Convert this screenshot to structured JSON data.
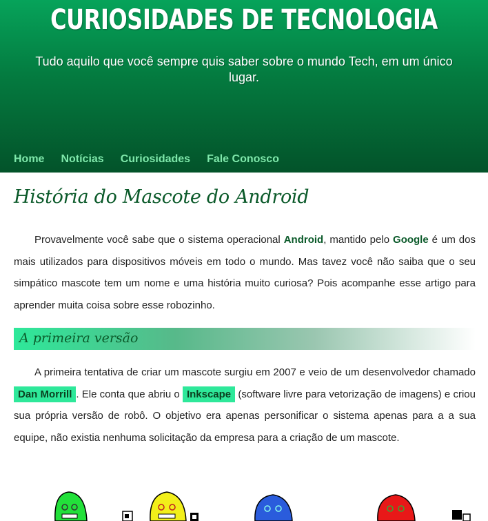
{
  "header": {
    "title": "CURIOSIDADES DE TECNOLOGIA",
    "subtitle": "Tudo aquilo que você sempre quis saber sobre o mundo Tech, em um único lugar."
  },
  "nav": {
    "items": [
      "Home",
      "Notícias",
      "Curiosidades",
      "Fale Conosco"
    ]
  },
  "article": {
    "title": "História do Mascote do Android",
    "intro": {
      "t1": "Provavelmente você sabe que o sistema operacional ",
      "android": "Android",
      "t2": ", mantido pelo ",
      "google": "Google",
      "t3": " é um dos mais utilizados para dispositivos móveis em todo o mundo. Mas tavez você não saiba que o seu simpático mascote tem um nome e uma história muito curiosa? Pois acompanhe esse artigo para aprender muita coisa sobre esse robozinho."
    },
    "section1": {
      "title": "A primeira versão",
      "t1": "A primeira tentativa de criar um mascote surgiu em 2007 e veio de um desenvolvedor chamado ",
      "name": "Dan Morrill",
      "t2": ". Ele conta que abriu o ",
      "software": "Inkscape",
      "t3": " (software livre para vetorização de imagens) e criou sua própria versão de robô. O objetivo era apenas personificar o sistema apenas para a a sua equipe, não existia nenhuma solicitação da empresa para a criação de um mascote."
    }
  },
  "colors": {
    "header_top": "#06a35a",
    "header_bottom": "#03532a",
    "nav_link": "#7fe8ab",
    "title_green": "#0b5a2a",
    "highlight": "#2ee89a"
  },
  "mascots": [
    "green",
    "yellow",
    "blue",
    "red"
  ]
}
